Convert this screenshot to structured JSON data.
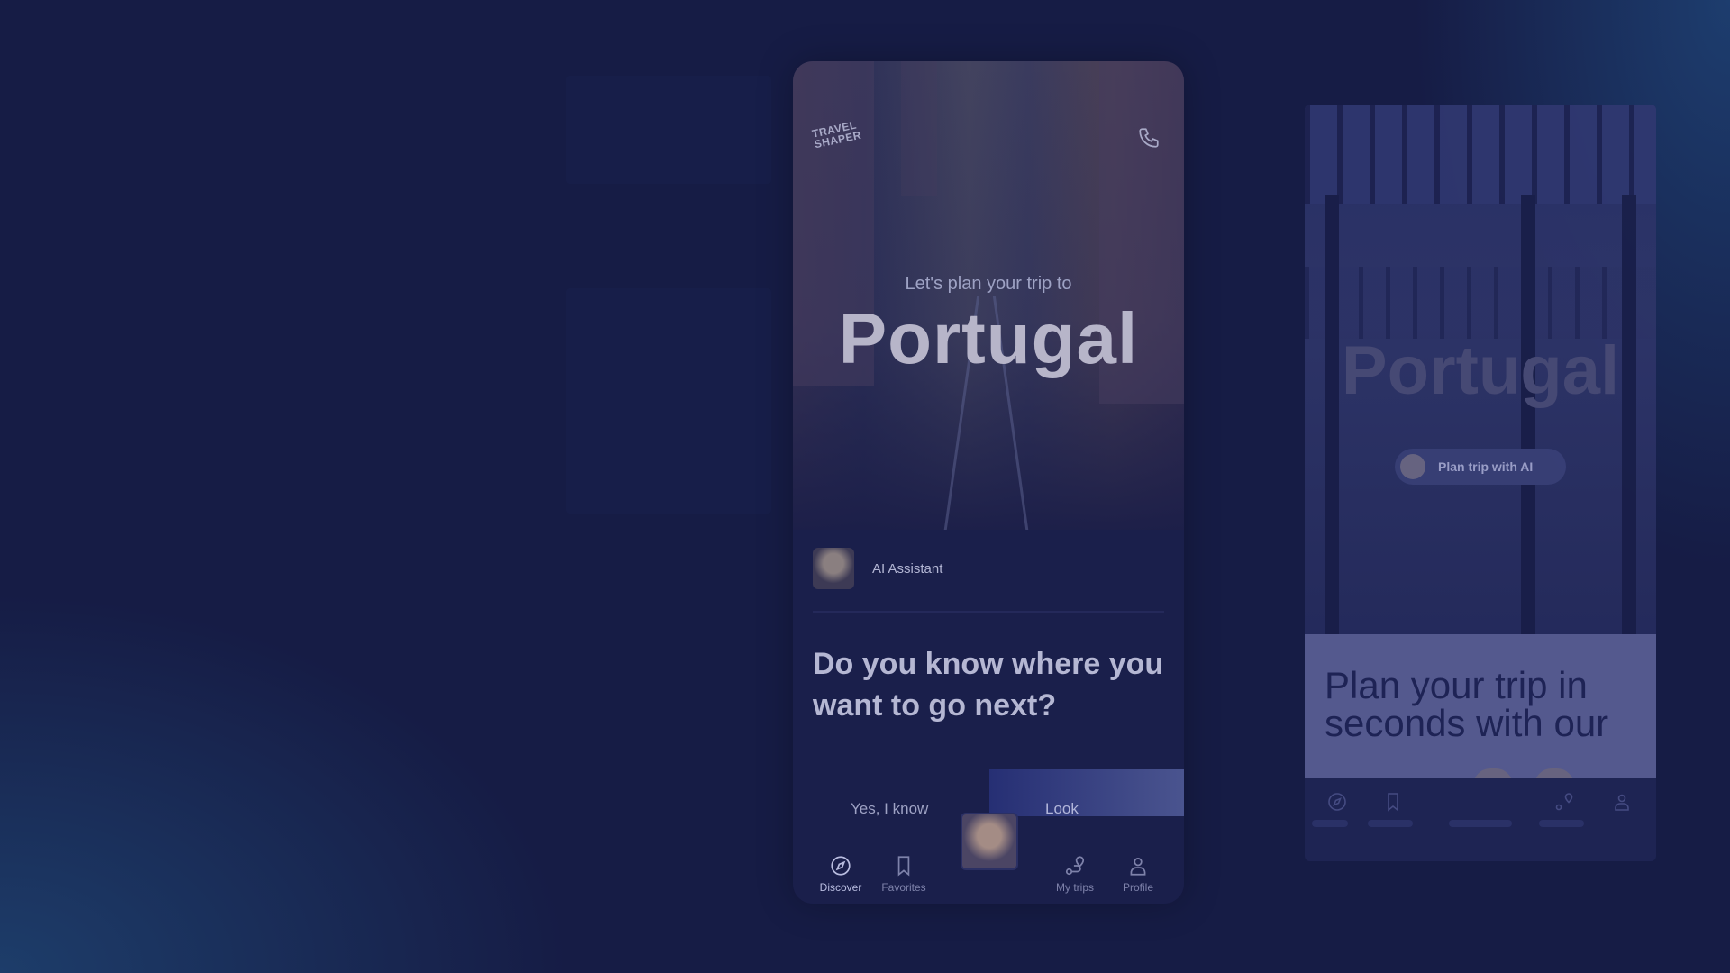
{
  "main_app": {
    "logo_text": "TRAVEL SHAPER",
    "hero": {
      "kicker": "Let's plan your trip to",
      "destination": "Portugal"
    },
    "assistant": {
      "name": "AI Assistant"
    },
    "question": "Do you know where you want to go next?",
    "choices": {
      "yes_label": "Yes, I know",
      "look_label": "Look"
    },
    "nav": [
      {
        "label": "Discover",
        "icon": "compass-icon",
        "active": true
      },
      {
        "label": "Favorites",
        "icon": "bookmark-icon",
        "active": false
      },
      {
        "label": "",
        "icon": "assistant-avatar",
        "active": false
      },
      {
        "label": "My trips",
        "icon": "route-pin-icon",
        "active": false
      },
      {
        "label": "Profile",
        "icon": "person-icon",
        "active": false
      }
    ]
  },
  "secondary_app": {
    "destination": "Portugal",
    "plan_button": "Plan trip with AI",
    "card_text": "Plan your trip in seconds with our"
  },
  "colors": {
    "background": "#161c45",
    "accent_gradient_start": "#262f74",
    "accent_gradient_end": "#4a548f"
  }
}
